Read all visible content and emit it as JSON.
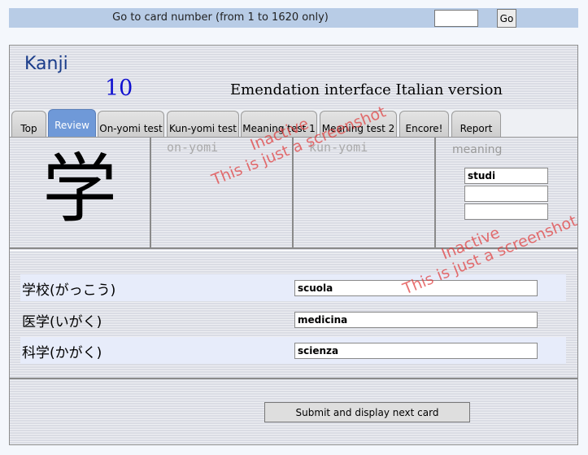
{
  "topbar": {
    "goto_label": "Go to card number (from 1 to 1620 only)",
    "card_input_value": "",
    "go_label": "Go"
  },
  "header": {
    "section_title": "Kanji",
    "card_number": "10",
    "interface_title": "Emendation interface  Italian version"
  },
  "tabs": [
    {
      "label": "Top",
      "active": false
    },
    {
      "label": "Review",
      "active": true
    },
    {
      "label": "On-yomi test",
      "active": false
    },
    {
      "label": "Kun-yomi test",
      "active": false
    },
    {
      "label": "Meaning test 1",
      "active": false
    },
    {
      "label": "Meaning test 2",
      "active": false
    },
    {
      "label": "Encore!",
      "active": false
    },
    {
      "label": "Report",
      "active": false
    }
  ],
  "kanji": {
    "character": "学",
    "on_yomi_label": "on-yomi",
    "kun_yomi_label": "kun-yomi",
    "meaning_label": "meaning",
    "meanings": [
      "studi",
      "",
      ""
    ]
  },
  "vocabulary": [
    {
      "word": "学校(がっこう)",
      "translation": "scuola"
    },
    {
      "word": "医学(いがく)",
      "translation": "medicina"
    },
    {
      "word": "科学(かがく)",
      "translation": "scienza"
    }
  ],
  "submit_label": "Submit and display next card",
  "watermark": {
    "line1": "Inactive",
    "line2": "This is just a screenshot"
  },
  "colors": {
    "topbar": "#b8cce6",
    "active_tab": "#6f99d8",
    "watermark": "#e13c3c",
    "heading": "#1a3c8a"
  }
}
